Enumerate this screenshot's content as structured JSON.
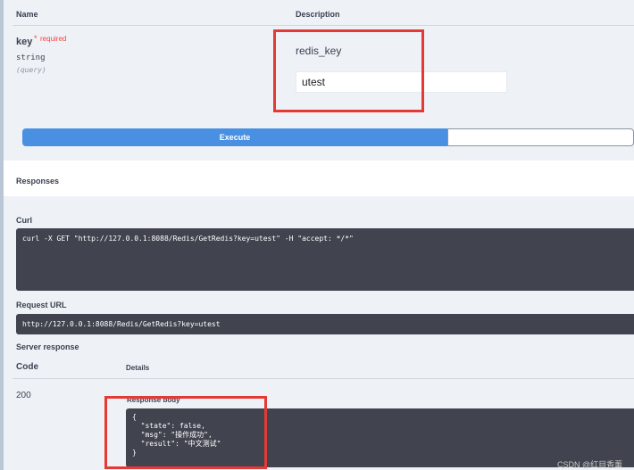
{
  "parameters": {
    "header_name": "Name",
    "header_description": "Description",
    "param": {
      "name": "key",
      "required_marker": "*",
      "required_text": "required",
      "type": "string",
      "location": "(query)",
      "description": "redis_key",
      "value": "utest"
    }
  },
  "actions": {
    "execute_label": "Execute"
  },
  "responses": {
    "title": "Responses",
    "curl_label": "Curl",
    "curl_command": "curl -X GET \"http://127.0.0.1:8088/Redis/GetRedis?key=utest\" -H \"accept: */*\"",
    "request_url_label": "Request URL",
    "request_url": "http://127.0.0.1:8088/Redis/GetRedis?key=utest",
    "server_response_label": "Server response",
    "col_code": "Code",
    "col_details": "Details",
    "status_code": "200",
    "response_body_label": "Response body",
    "response_body": "{\n  \"state\": false,\n  \"msg\": \"操作成功\",\n  \"result\": \"中文测试\"\n}"
  },
  "watermark": "CSDN @红目香薰",
  "colors": {
    "execute": "#4990e2",
    "code_bg": "#41444e",
    "highlight": "#e53935",
    "required": "#f93e3e"
  }
}
